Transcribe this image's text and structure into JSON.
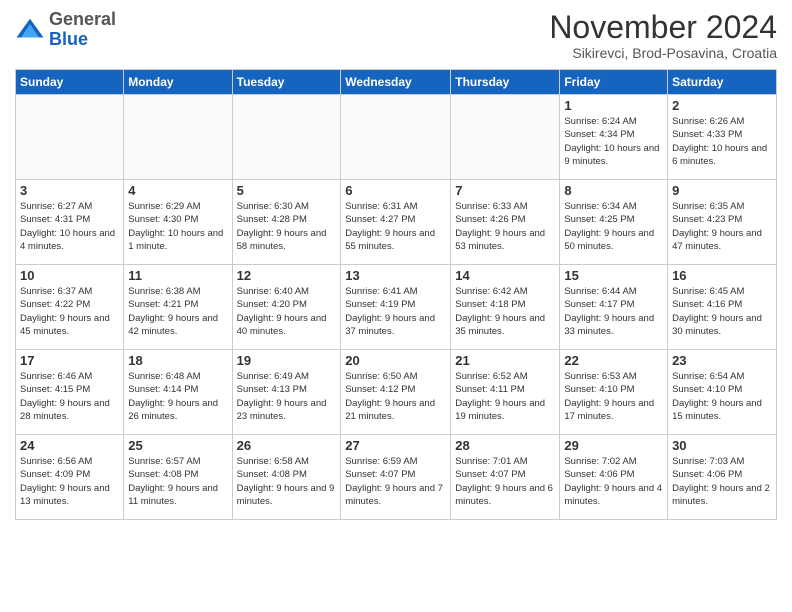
{
  "logo": {
    "general": "General",
    "blue": "Blue"
  },
  "header": {
    "month": "November 2024",
    "location": "Sikirevci, Brod-Posavina, Croatia"
  },
  "weekdays": [
    "Sunday",
    "Monday",
    "Tuesday",
    "Wednesday",
    "Thursday",
    "Friday",
    "Saturday"
  ],
  "weeks": [
    [
      {
        "day": "",
        "info": ""
      },
      {
        "day": "",
        "info": ""
      },
      {
        "day": "",
        "info": ""
      },
      {
        "day": "",
        "info": ""
      },
      {
        "day": "",
        "info": ""
      },
      {
        "day": "1",
        "info": "Sunrise: 6:24 AM\nSunset: 4:34 PM\nDaylight: 10 hours and 9 minutes."
      },
      {
        "day": "2",
        "info": "Sunrise: 6:26 AM\nSunset: 4:33 PM\nDaylight: 10 hours and 6 minutes."
      }
    ],
    [
      {
        "day": "3",
        "info": "Sunrise: 6:27 AM\nSunset: 4:31 PM\nDaylight: 10 hours and 4 minutes."
      },
      {
        "day": "4",
        "info": "Sunrise: 6:29 AM\nSunset: 4:30 PM\nDaylight: 10 hours and 1 minute."
      },
      {
        "day": "5",
        "info": "Sunrise: 6:30 AM\nSunset: 4:28 PM\nDaylight: 9 hours and 58 minutes."
      },
      {
        "day": "6",
        "info": "Sunrise: 6:31 AM\nSunset: 4:27 PM\nDaylight: 9 hours and 55 minutes."
      },
      {
        "day": "7",
        "info": "Sunrise: 6:33 AM\nSunset: 4:26 PM\nDaylight: 9 hours and 53 minutes."
      },
      {
        "day": "8",
        "info": "Sunrise: 6:34 AM\nSunset: 4:25 PM\nDaylight: 9 hours and 50 minutes."
      },
      {
        "day": "9",
        "info": "Sunrise: 6:35 AM\nSunset: 4:23 PM\nDaylight: 9 hours and 47 minutes."
      }
    ],
    [
      {
        "day": "10",
        "info": "Sunrise: 6:37 AM\nSunset: 4:22 PM\nDaylight: 9 hours and 45 minutes."
      },
      {
        "day": "11",
        "info": "Sunrise: 6:38 AM\nSunset: 4:21 PM\nDaylight: 9 hours and 42 minutes."
      },
      {
        "day": "12",
        "info": "Sunrise: 6:40 AM\nSunset: 4:20 PM\nDaylight: 9 hours and 40 minutes."
      },
      {
        "day": "13",
        "info": "Sunrise: 6:41 AM\nSunset: 4:19 PM\nDaylight: 9 hours and 37 minutes."
      },
      {
        "day": "14",
        "info": "Sunrise: 6:42 AM\nSunset: 4:18 PM\nDaylight: 9 hours and 35 minutes."
      },
      {
        "day": "15",
        "info": "Sunrise: 6:44 AM\nSunset: 4:17 PM\nDaylight: 9 hours and 33 minutes."
      },
      {
        "day": "16",
        "info": "Sunrise: 6:45 AM\nSunset: 4:16 PM\nDaylight: 9 hours and 30 minutes."
      }
    ],
    [
      {
        "day": "17",
        "info": "Sunrise: 6:46 AM\nSunset: 4:15 PM\nDaylight: 9 hours and 28 minutes."
      },
      {
        "day": "18",
        "info": "Sunrise: 6:48 AM\nSunset: 4:14 PM\nDaylight: 9 hours and 26 minutes."
      },
      {
        "day": "19",
        "info": "Sunrise: 6:49 AM\nSunset: 4:13 PM\nDaylight: 9 hours and 23 minutes."
      },
      {
        "day": "20",
        "info": "Sunrise: 6:50 AM\nSunset: 4:12 PM\nDaylight: 9 hours and 21 minutes."
      },
      {
        "day": "21",
        "info": "Sunrise: 6:52 AM\nSunset: 4:11 PM\nDaylight: 9 hours and 19 minutes."
      },
      {
        "day": "22",
        "info": "Sunrise: 6:53 AM\nSunset: 4:10 PM\nDaylight: 9 hours and 17 minutes."
      },
      {
        "day": "23",
        "info": "Sunrise: 6:54 AM\nSunset: 4:10 PM\nDaylight: 9 hours and 15 minutes."
      }
    ],
    [
      {
        "day": "24",
        "info": "Sunrise: 6:56 AM\nSunset: 4:09 PM\nDaylight: 9 hours and 13 minutes."
      },
      {
        "day": "25",
        "info": "Sunrise: 6:57 AM\nSunset: 4:08 PM\nDaylight: 9 hours and 11 minutes."
      },
      {
        "day": "26",
        "info": "Sunrise: 6:58 AM\nSunset: 4:08 PM\nDaylight: 9 hours and 9 minutes."
      },
      {
        "day": "27",
        "info": "Sunrise: 6:59 AM\nSunset: 4:07 PM\nDaylight: 9 hours and 7 minutes."
      },
      {
        "day": "28",
        "info": "Sunrise: 7:01 AM\nSunset: 4:07 PM\nDaylight: 9 hours and 6 minutes."
      },
      {
        "day": "29",
        "info": "Sunrise: 7:02 AM\nSunset: 4:06 PM\nDaylight: 9 hours and 4 minutes."
      },
      {
        "day": "30",
        "info": "Sunrise: 7:03 AM\nSunset: 4:06 PM\nDaylight: 9 hours and 2 minutes."
      }
    ]
  ]
}
